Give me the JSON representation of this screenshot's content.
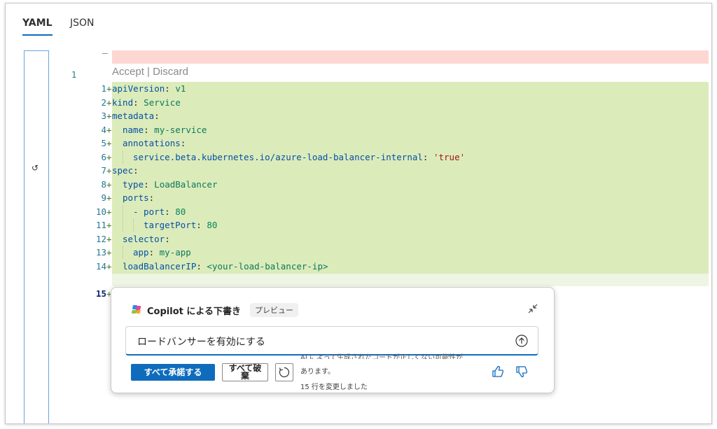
{
  "tabs": [
    {
      "label": "YAML",
      "active": true
    },
    {
      "label": "JSON",
      "active": false
    }
  ],
  "editor": {
    "original_line_number": "1",
    "codelens": {
      "accept": "Accept",
      "separator": " | ",
      "discard": "Discard"
    },
    "lines": [
      {
        "n": "1",
        "key": "apiVersion",
        "val": "v1",
        "indent": 0
      },
      {
        "n": "2",
        "key": "kind",
        "val": "Service",
        "indent": 0
      },
      {
        "n": "3",
        "key": "metadata",
        "val": "",
        "indent": 0
      },
      {
        "n": "4",
        "key": "name",
        "val": "my-service",
        "indent": 1
      },
      {
        "n": "5",
        "key": "annotations",
        "val": "",
        "indent": 1
      },
      {
        "n": "6",
        "key": "service.beta.kubernetes.io/azure-load-balancer-internal",
        "val": "'true'",
        "indent": 2
      },
      {
        "n": "7",
        "key": "spec",
        "val": "",
        "indent": 0
      },
      {
        "n": "8",
        "key": "type",
        "val": "LoadBalancer",
        "indent": 1
      },
      {
        "n": "9",
        "key": "ports",
        "val": "",
        "indent": 1
      },
      {
        "n": "10",
        "key": "- port",
        "val": "80",
        "indent": 2
      },
      {
        "n": "11",
        "key": "targetPort",
        "val": "80",
        "indent": 3
      },
      {
        "n": "12",
        "key": "selector",
        "val": "",
        "indent": 1
      },
      {
        "n": "13",
        "key": "app",
        "val": "my-app",
        "indent": 2
      },
      {
        "n": "14",
        "key": "loadBalancerIP",
        "val": "<your-load-balancer-ip>",
        "indent": 1
      }
    ],
    "last_line_number": "15"
  },
  "copilot": {
    "title": "Copilot による下書き",
    "badge": "プレビュー",
    "prompt": "ロードバンサーを有効にする",
    "accept_all": "すべて承諾する",
    "discard_all": "すべて破棄",
    "notice_cut": "AI によって生成されたコードが正しくない可能性が",
    "notice_end": "あります。",
    "changed": "15 行を変更しました"
  }
}
